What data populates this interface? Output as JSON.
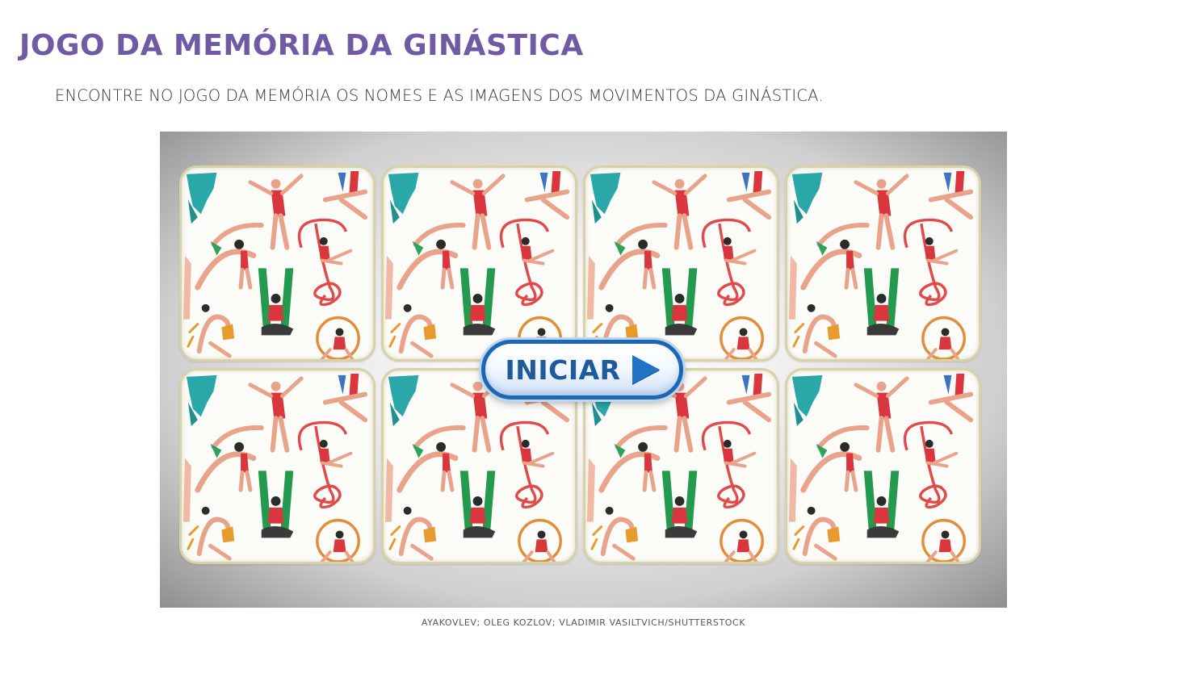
{
  "page": {
    "title": "JOGO DA MEMÓRIA DA GINÁSTICA",
    "subtitle": "ENCONTRE NO JOGO DA MEMÓRIA OS NOMES E AS IMAGENS DOS MOVIMENTOS DA GINÁSTICA.",
    "credit": "AYAKOVLEV; OLEG KOZLOV; VLADIMIR VASILTVICH/SHUTTERSTOCK"
  },
  "game": {
    "start_label": "INICIAR",
    "start_icon": "play-icon",
    "cards_face": "gymnasts-card-back",
    "card_count": 8,
    "colors": {
      "title": "#6f5aa3",
      "button_border": "#1c66b4",
      "button_text": "#1f5a9c",
      "play_icon": "#2173c6"
    }
  }
}
